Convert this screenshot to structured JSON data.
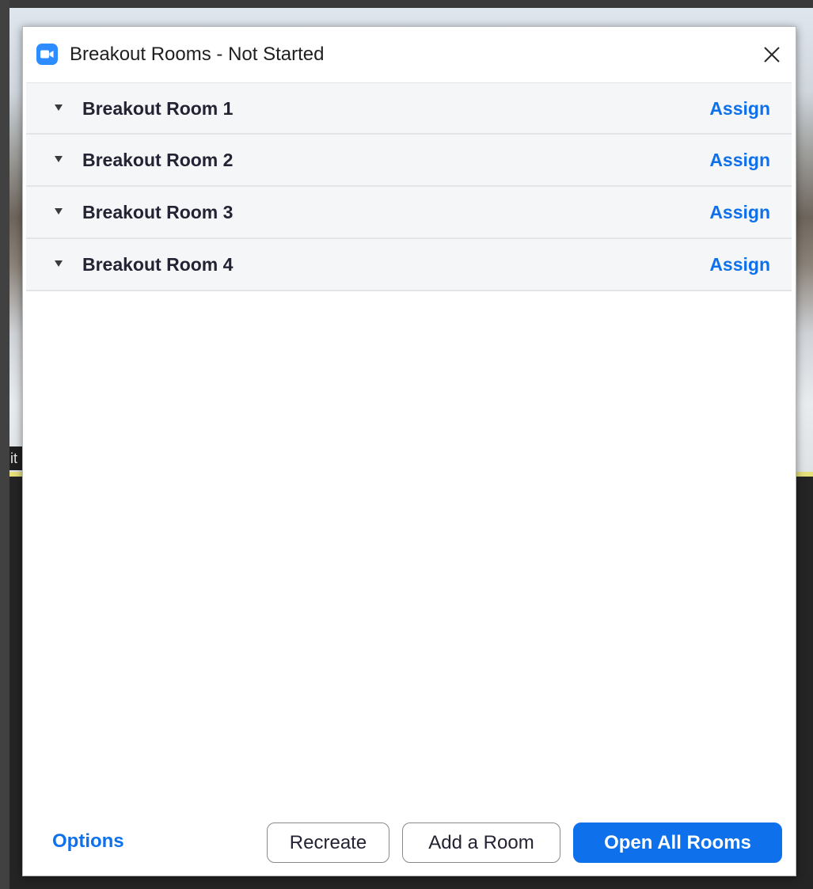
{
  "window": {
    "title": "Breakout Rooms - Not Started",
    "app_icon": "zoom-camera-icon",
    "close_icon": "close-icon"
  },
  "background": {
    "left_label": "it"
  },
  "rooms": [
    {
      "name": "Breakout Room 1",
      "action": "Assign"
    },
    {
      "name": "Breakout Room 2",
      "action": "Assign"
    },
    {
      "name": "Breakout Room 3",
      "action": "Assign"
    },
    {
      "name": "Breakout Room 4",
      "action": "Assign"
    }
  ],
  "footer": {
    "options_label": "Options",
    "recreate_label": "Recreate",
    "add_room_label": "Add a Room",
    "open_all_label": "Open All Rooms"
  },
  "colors": {
    "accent": "#0e71eb",
    "row_background": "#f5f6f8",
    "app_icon_blue": "#2d8cff"
  }
}
